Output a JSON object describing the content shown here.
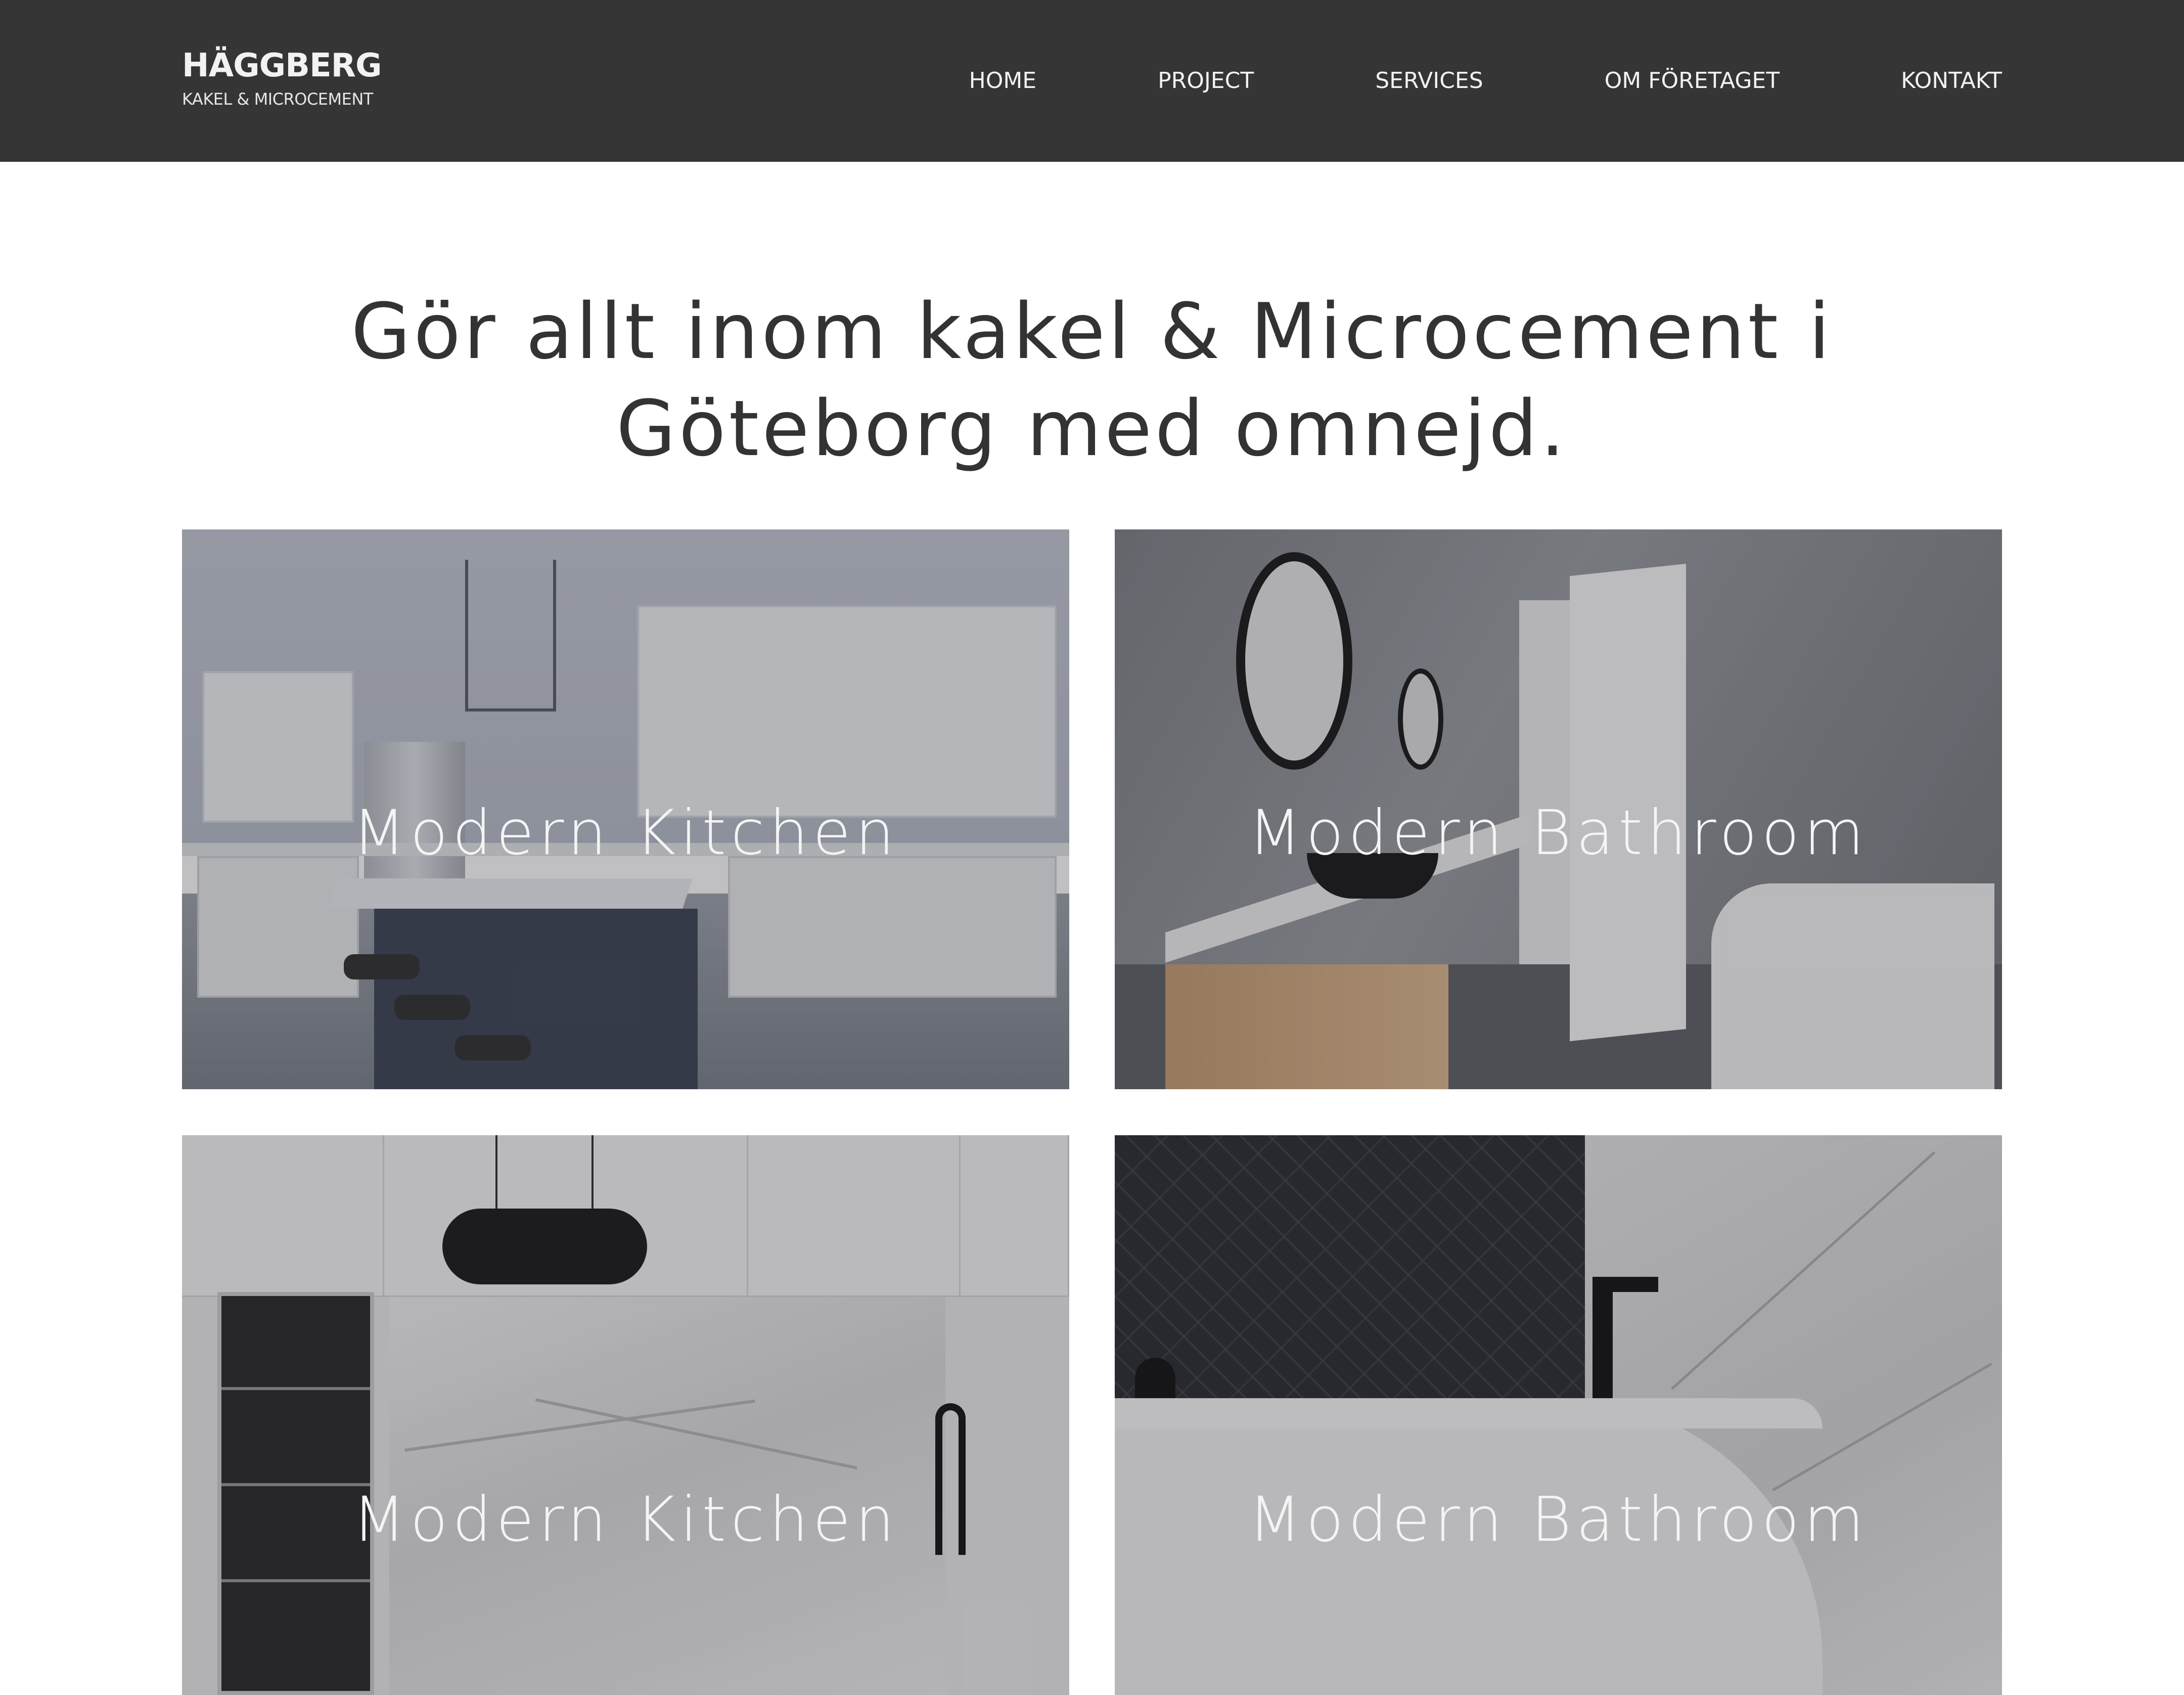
{
  "header": {
    "brand_name": "HÄGGBERG",
    "brand_tagline": "KAKEL & MICROCEMENT",
    "nav": [
      {
        "label": "HOME"
      },
      {
        "label": "PROJECT"
      },
      {
        "label": "SERVICES"
      },
      {
        "label": "OM FÖRETAGET"
      },
      {
        "label": "KONTAKT"
      }
    ]
  },
  "hero": {
    "headline_line1": "Gör allt inom kakel & Microcement i",
    "headline_line2": "Göteborg med omnejd."
  },
  "projects": [
    {
      "title": "Modern Kitchen"
    },
    {
      "title": "Modern Bathroom"
    },
    {
      "title": "Modern Kitchen"
    },
    {
      "title": "Modern Bathroom"
    }
  ],
  "colors": {
    "header_bg": "#353535",
    "page_bg": "#ffffff",
    "headline_text": "#333333",
    "card_title_text": "#f4f4f4"
  }
}
